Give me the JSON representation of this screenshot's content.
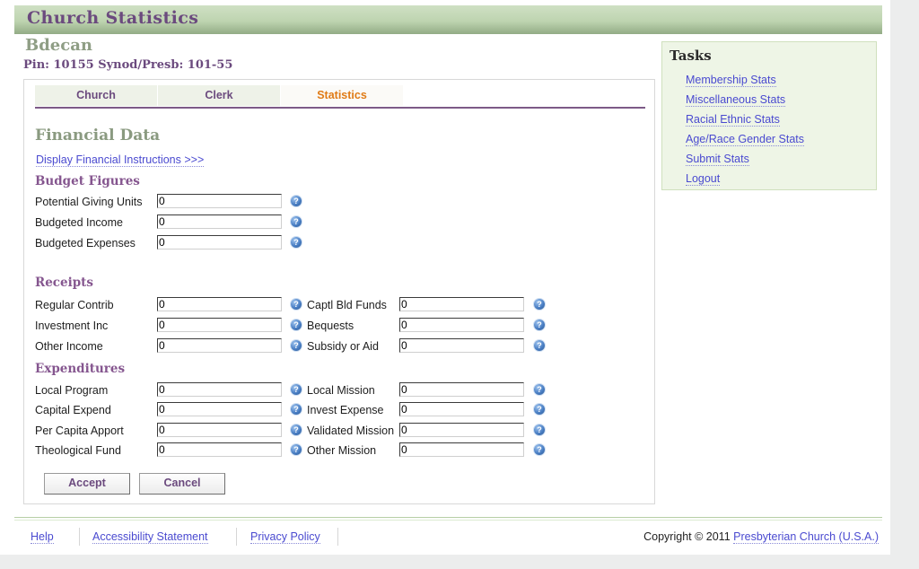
{
  "header": {
    "title": "Church Statistics",
    "church_name": "Bdecan",
    "pin_line": "Pin: 10155  Synod/Presb: 101-55"
  },
  "tabs": [
    {
      "label": "Church",
      "active": false
    },
    {
      "label": "Clerk",
      "active": false
    },
    {
      "label": "Statistics",
      "active": true
    }
  ],
  "form": {
    "heading": "Financial Data",
    "instructions_link": "Display Financial Instructions >>>",
    "help_icon_glyph": "?",
    "groups": {
      "budget": {
        "title": "Budget Figures",
        "rows": [
          {
            "label": "Potential Giving Units",
            "value": "0"
          },
          {
            "label": "Budgeted Income",
            "value": "0"
          },
          {
            "label": "Budgeted Expenses",
            "value": "0"
          }
        ]
      },
      "receipts": {
        "title": "Receipts",
        "rows": [
          {
            "left_label": "Regular Contrib",
            "left_value": "0",
            "right_label": "Captl Bld Funds",
            "right_value": "0"
          },
          {
            "left_label": "Investment Inc",
            "left_value": "0",
            "right_label": "Bequests",
            "right_value": "0"
          },
          {
            "left_label": "Other Income",
            "left_value": "0",
            "right_label": "Subsidy or Aid",
            "right_value": "0"
          }
        ]
      },
      "expenditures": {
        "title": "Expenditures",
        "rows": [
          {
            "left_label": "Local Program",
            "left_value": "0",
            "right_label": "Local Mission",
            "right_value": "0"
          },
          {
            "left_label": "Capital Expend",
            "left_value": "0",
            "right_label": "Invest Expense",
            "right_value": "0"
          },
          {
            "left_label": "Per Capita Apport",
            "left_value": "0",
            "right_label": "Validated Mission",
            "right_value": "0"
          },
          {
            "left_label": "Theological Fund",
            "left_value": "0",
            "right_label": "Other Mission",
            "right_value": "0"
          }
        ]
      }
    },
    "accept_label": "Accept",
    "cancel_label": "Cancel"
  },
  "tasks": {
    "title": "Tasks",
    "items": [
      {
        "label": "Membership Stats"
      },
      {
        "label": "Miscellaneous Stats"
      },
      {
        "label": "Racial Ethnic Stats"
      },
      {
        "label": "Age/Race Gender Stats"
      },
      {
        "label": "Submit Stats"
      },
      {
        "label": "Logout"
      }
    ]
  },
  "footer": {
    "links": [
      {
        "label": "Help"
      },
      {
        "label": "Accessibility Statement"
      },
      {
        "label": "Privacy Policy"
      }
    ],
    "copyright_prefix": "Copyright © 2011 ",
    "copyright_link": "Presbyterian Church (U.S.A.)"
  },
  "colors": {
    "header_green": "#bed4b0",
    "accent_purple": "#6b4a7e",
    "active_tab_orange": "#e07b16",
    "link_blue": "#4a4ad0",
    "tasks_bg": "#eef5e6"
  }
}
